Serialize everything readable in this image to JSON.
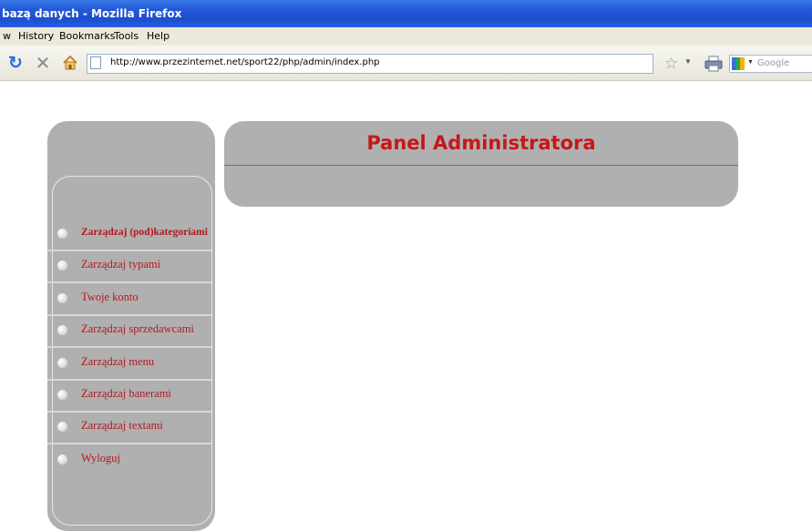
{
  "browser": {
    "window_title": "bazą danych - Mozilla Firefox",
    "menu": [
      "w",
      "History",
      "Bookmarks",
      "Tools",
      "Help"
    ],
    "url": "http://www.przezinternet.net/sport22/php/admin/index.php",
    "search_placeholder": "Google"
  },
  "page": {
    "title": "Panel Administratora",
    "accent_color": "#c4181a",
    "panel_color": "#b0b0b0",
    "nav": [
      {
        "label": "Zarządzaj (pod)kategoriami",
        "active": true
      },
      {
        "label": "Zarządzaj typami"
      },
      {
        "label": "Twoje konto"
      },
      {
        "label": "Zarządzaj sprzedawcami"
      },
      {
        "label": "Zarządzaj menu"
      },
      {
        "label": "Zarządzaj banerami"
      },
      {
        "label": "Zarządzaj textami"
      },
      {
        "label": "Wyloguj"
      }
    ]
  }
}
